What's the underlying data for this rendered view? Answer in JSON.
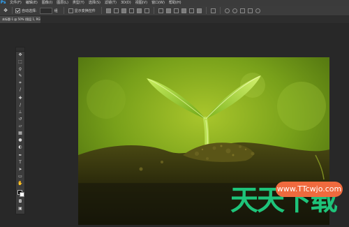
{
  "app": {
    "logo": "Ps"
  },
  "menu": [
    "文件(F)",
    "编辑(E)",
    "图像(I)",
    "图层(L)",
    "类型(Y)",
    "选择(S)",
    "滤镜(T)",
    "3D(D)",
    "视图(V)",
    "窗口(W)",
    "帮助(H)"
  ],
  "options_bar": {
    "auto_select_label": "自动选择:",
    "auto_select_checked": true,
    "group_value": "组",
    "transform_label": "显示变换控件",
    "transform_checked": false
  },
  "document_tab": {
    "label": "未标题-1 @ 50% (图层 1, RGB/8)"
  },
  "watermark": {
    "logo_text": "天天下载",
    "url": "www.TTcwjo.com"
  },
  "colors": {
    "photoshop_blue": "#31a8ff",
    "watermark_green": "#1ec47a",
    "watermark_orange": "#f06a3e",
    "ui_dark": "#282828"
  },
  "icons": [
    "move-tool-icon",
    "marquee-tool-icon",
    "lasso-tool-icon",
    "quick-select-tool-icon",
    "crop-tool-icon",
    "eyedropper-tool-icon",
    "healing-brush-tool-icon",
    "brush-tool-icon",
    "clone-stamp-tool-icon",
    "history-brush-tool-icon",
    "eraser-tool-icon",
    "gradient-tool-icon",
    "blur-tool-icon",
    "dodge-tool-icon",
    "pen-tool-icon",
    "type-tool-icon",
    "path-selection-tool-icon",
    "rectangle-tool-icon",
    "hand-tool-icon",
    "zoom-tool-icon"
  ]
}
